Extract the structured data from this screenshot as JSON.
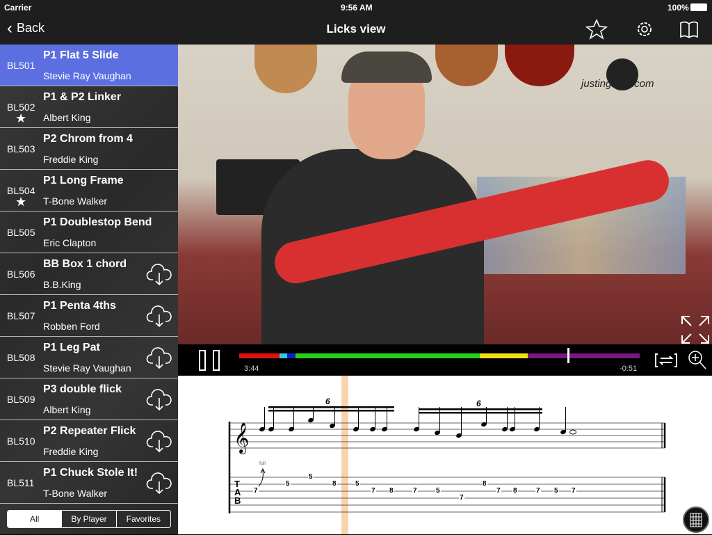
{
  "status": {
    "carrier": "Carrier",
    "time": "9:56 AM",
    "battery": "100%"
  },
  "nav": {
    "back": "Back",
    "title": "Licks view"
  },
  "licks": [
    {
      "code": "BL501",
      "title": "P1 Flat 5 Slide",
      "player": "Stevie Ray Vaughan",
      "favorite": false,
      "download": false,
      "selected": true
    },
    {
      "code": "BL502",
      "title": "P1 & P2 Linker",
      "player": "Albert King",
      "favorite": true,
      "download": false
    },
    {
      "code": "BL503",
      "title": "P2 Chrom from 4",
      "player": "Freddie King",
      "favorite": false,
      "download": false
    },
    {
      "code": "BL504",
      "title": "P1 Long Frame",
      "player": "T-Bone Walker",
      "favorite": true,
      "download": false
    },
    {
      "code": "BL505",
      "title": "P1 Doublestop Bend",
      "player": "Eric Clapton",
      "favorite": false,
      "download": false
    },
    {
      "code": "BL506",
      "title": "BB Box 1 chord",
      "player": "B.B.King",
      "favorite": false,
      "download": true
    },
    {
      "code": "BL507",
      "title": "P1 Penta 4ths",
      "player": "Robben Ford",
      "favorite": false,
      "download": true
    },
    {
      "code": "BL508",
      "title": "P1 Leg Pat",
      "player": "Stevie Ray Vaughan",
      "favorite": false,
      "download": true
    },
    {
      "code": "BL509",
      "title": "P3 double flick",
      "player": "Albert King",
      "favorite": false,
      "download": true
    },
    {
      "code": "BL510",
      "title": "P2 Repeater Flick",
      "player": "Freddie King",
      "favorite": false,
      "download": true
    },
    {
      "code": "BL511",
      "title": "P1 Chuck Stole It!",
      "player": "T-Bone Walker",
      "favorite": false,
      "download": true
    }
  ],
  "filters": [
    "All",
    "By Player",
    "Favorites"
  ],
  "video": {
    "watermark": "justinguitar.com"
  },
  "player": {
    "elapsed": "3:44",
    "remaining": "-0:51",
    "progress": 0.82,
    "segments": [
      {
        "color": "#e01010",
        "to": 0.1
      },
      {
        "color": "#30c8e8",
        "to": 0.12
      },
      {
        "color": "#1020c0",
        "to": 0.14
      },
      {
        "color": "#22d020",
        "to": 0.6
      },
      {
        "color": "#f0e010",
        "to": 0.72
      },
      {
        "color": "#7a1880",
        "to": 1.0
      }
    ]
  },
  "notation": {
    "tuplet1": "6",
    "tuplet2": "6",
    "bend": "full",
    "tab_label": [
      "T",
      "A",
      "B"
    ],
    "tab": [
      {
        "fret": "7",
        "string": 3
      },
      {
        "fret": "5",
        "string": 2
      },
      {
        "fret": "5",
        "string": 1
      },
      {
        "fret": "8",
        "string": 2
      },
      {
        "fret": "5",
        "string": 2
      },
      {
        "fret": "7",
        "string": 3
      },
      {
        "fret": "8",
        "string": 3
      },
      {
        "fret": "7",
        "string": 3
      },
      {
        "fret": "5",
        "string": 3
      },
      {
        "fret": "7",
        "string": 4
      },
      {
        "fret": "8",
        "string": 2
      },
      {
        "fret": "7",
        "string": 3
      },
      {
        "fret": "8",
        "string": 3
      },
      {
        "fret": "7",
        "string": 3
      },
      {
        "fret": "5",
        "string": 3
      },
      {
        "fret": "7",
        "string": 3
      }
    ]
  }
}
